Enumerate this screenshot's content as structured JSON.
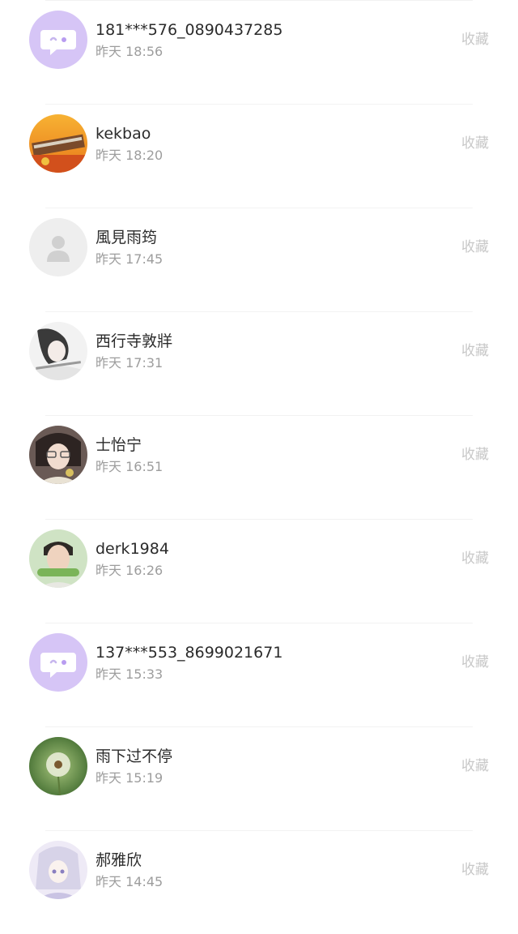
{
  "records": [
    {
      "name": "181***576_0890437285",
      "time": "昨天 18:56",
      "action": "收藏",
      "avatar": "chat-bubble-icon"
    },
    {
      "name": "kekbao",
      "time": "昨天 18:20",
      "action": "收藏",
      "avatar": "photo-orange"
    },
    {
      "name": "風見雨筠",
      "time": "昨天 17:45",
      "action": "收藏",
      "avatar": "default-person-icon"
    },
    {
      "name": "西行寺敦牂",
      "time": "昨天 17:31",
      "action": "收藏",
      "avatar": "photo-girl-sketch"
    },
    {
      "name": "士怡宁",
      "time": "昨天 16:51",
      "action": "收藏",
      "avatar": "photo-girl-glasses"
    },
    {
      "name": "derk1984",
      "time": "昨天 16:26",
      "action": "收藏",
      "avatar": "photo-man-green"
    },
    {
      "name": "137***553_8699021671",
      "time": "昨天 15:33",
      "action": "收藏",
      "avatar": "chat-bubble-icon"
    },
    {
      "name": "雨下过不停",
      "time": "昨天 15:19",
      "action": "收藏",
      "avatar": "photo-dandelion"
    },
    {
      "name": "郝雅欣",
      "time": "昨天 14:45",
      "action": "收藏",
      "avatar": "photo-anime-girl"
    }
  ],
  "colors": {
    "accent_purple": "#c8b3f3",
    "name_text": "#2b2b2b",
    "time_text": "#9d9d9d",
    "action_text": "#c8c8c8"
  }
}
